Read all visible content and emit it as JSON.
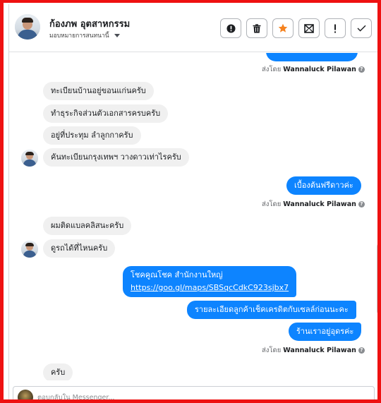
{
  "header": {
    "contact_name": "ก้องภพ อุตสาหกรรม",
    "assign_label": "มอบหมายการสนทนานี้",
    "actions": [
      {
        "name": "mark-spam-button",
        "icon": "alert-circle-icon"
      },
      {
        "name": "delete-button",
        "icon": "trash-icon"
      },
      {
        "name": "star-button",
        "icon": "star-icon"
      },
      {
        "name": "mark-unread-button",
        "icon": "envelope-icon"
      },
      {
        "name": "follow-up-button",
        "icon": "exclamation-icon"
      },
      {
        "name": "mark-done-button",
        "icon": "check-icon"
      }
    ]
  },
  "messages": {
    "top_partial": "",
    "sentby_prefix": "ส่งโดย",
    "sender_name": "Wannaluck Pilawan",
    "in_1": "ทะเบียนบ้านอยู่ขอนแก่นครับ",
    "in_2": "ทำธุระกิจส่วนตัวเอกสารครบครับ",
    "in_3": "อยู่ที่ประทุม ลำลูกกาครับ",
    "in_4": "คันทะเบียนกรุงเทพฯ วางดาวเท่าไรครับ",
    "out_1": "เบื้องต้นฟรีดาวค่ะ",
    "in_5": "ผมติดแบลคลิสนะครับ",
    "in_6": "ดูรถได้ที่ไหนครับ",
    "out_2_line1": "โชคคูณโชค สำนักงานใหญ่",
    "out_2_link": "https://goo.gl/maps/SBSqcCdkC923sjbx7",
    "out_3": "รายละเอียดลูกค้าเช็คเครดิตกับเซลล์ก่อนนะคะ",
    "out_4": "ร้านเราอยู่อุดรค่ะ",
    "in_7": "ครับ"
  },
  "composer": {
    "placeholder": "ตอบกลับใน Messenger..."
  },
  "colors": {
    "frame": "#ee1111",
    "outgoing_bubble": "#0d84ff",
    "incoming_bubble": "#f0f0f0"
  }
}
